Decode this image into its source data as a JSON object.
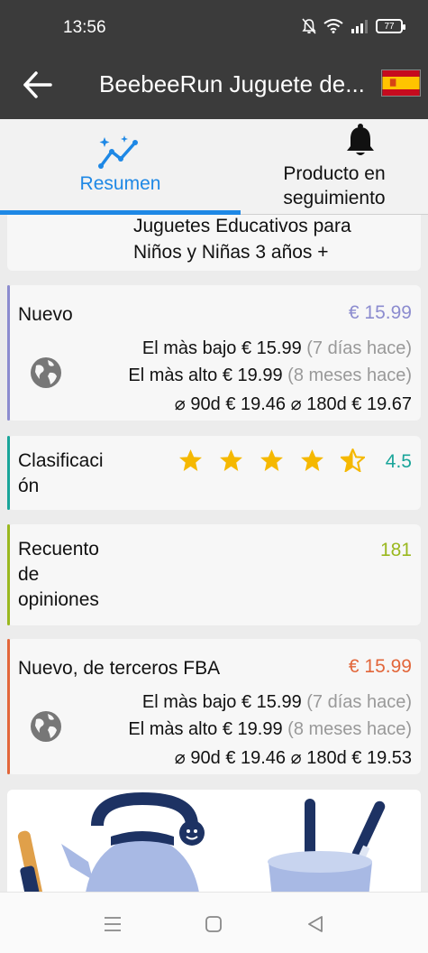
{
  "status": {
    "time": "13:56",
    "battery": "77"
  },
  "appbar": {
    "title": "BeebeeRun Juguete de..."
  },
  "tabs": [
    {
      "label": "Resumen",
      "icon": "sparkle-chart-icon",
      "active": true
    },
    {
      "label": "Producto en seguimiento",
      "icon": "bell-icon",
      "active": false
    }
  ],
  "product_title_tail": {
    "line1": "Juguetes Educativos para",
    "line2": "Niños y Niñas 3 años +"
  },
  "nuevo": {
    "label": "Nuevo",
    "price": "€ 15.99",
    "lowest_label": "El màs bajo",
    "lowest_price": "€ 15.99",
    "lowest_when": "(7 días hace)",
    "highest_label": "El màs alto",
    "highest_price": "€ 19.99",
    "highest_when": "(8 meses hace)",
    "avg90_label": "⌀ 90d",
    "avg90": "€ 19.46",
    "avg180_label": "⌀ 180d",
    "avg180": "€ 19.67",
    "accent": "#8c8ccf"
  },
  "clasificacion": {
    "label_l1": "Clasificaci",
    "label_l2": "ón",
    "rating": 4.5,
    "value": "4.5",
    "accent": "#1aa59a",
    "star_color": "#f5b800"
  },
  "opiniones": {
    "label_l1": "Recuento",
    "label_l2": "de",
    "label_l3": "opiniones",
    "value": "181",
    "accent": "#9ab81f"
  },
  "fba": {
    "label": "Nuevo, de terceros FBA",
    "price": "€ 15.99",
    "lowest_label": "El màs bajo",
    "lowest_price": "€ 15.99",
    "lowest_when": "(7 días hace)",
    "highest_label": "El màs alto",
    "highest_price": "€ 19.99",
    "highest_when": "(8 meses hace)",
    "avg90_label": "⌀ 90d",
    "avg90": "€ 19.46",
    "avg180_label": "⌀ 180d",
    "avg180": "€ 19.53",
    "accent": "#e2663a"
  },
  "colors": {
    "header": "#3b3b3b",
    "tab_active": "#1e88e5"
  }
}
